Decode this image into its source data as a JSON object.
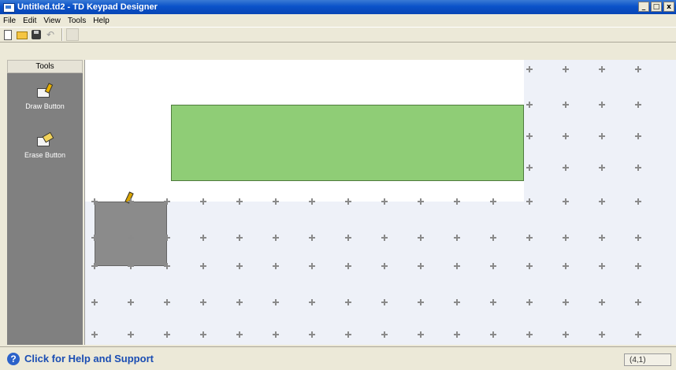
{
  "window": {
    "title": "Untitled.td2 - TD Keypad Designer",
    "controls": [
      "minimize",
      "maximize",
      "close"
    ]
  },
  "menu": [
    "File",
    "Edit",
    "View",
    "Tools",
    "Help"
  ],
  "toolbar": {
    "icons": [
      "new-document-icon",
      "open-folder-icon",
      "save-icon",
      "undo-icon",
      "disabled-tool-icon"
    ],
    "undo_glyph": "↶"
  },
  "tools_panel": {
    "header": "Tools",
    "items": [
      {
        "label": "Draw Button",
        "icon": "draw-button-icon"
      },
      {
        "label": "Erase Button",
        "icon": "erase-button-icon"
      }
    ]
  },
  "canvas": {
    "placed_button_color": "#8fcd76",
    "selection_color": "#8b8b8b"
  },
  "statusbar": {
    "help_text": "Click for Help and Support",
    "help_glyph": "?",
    "coordinates": "(4,1)"
  }
}
